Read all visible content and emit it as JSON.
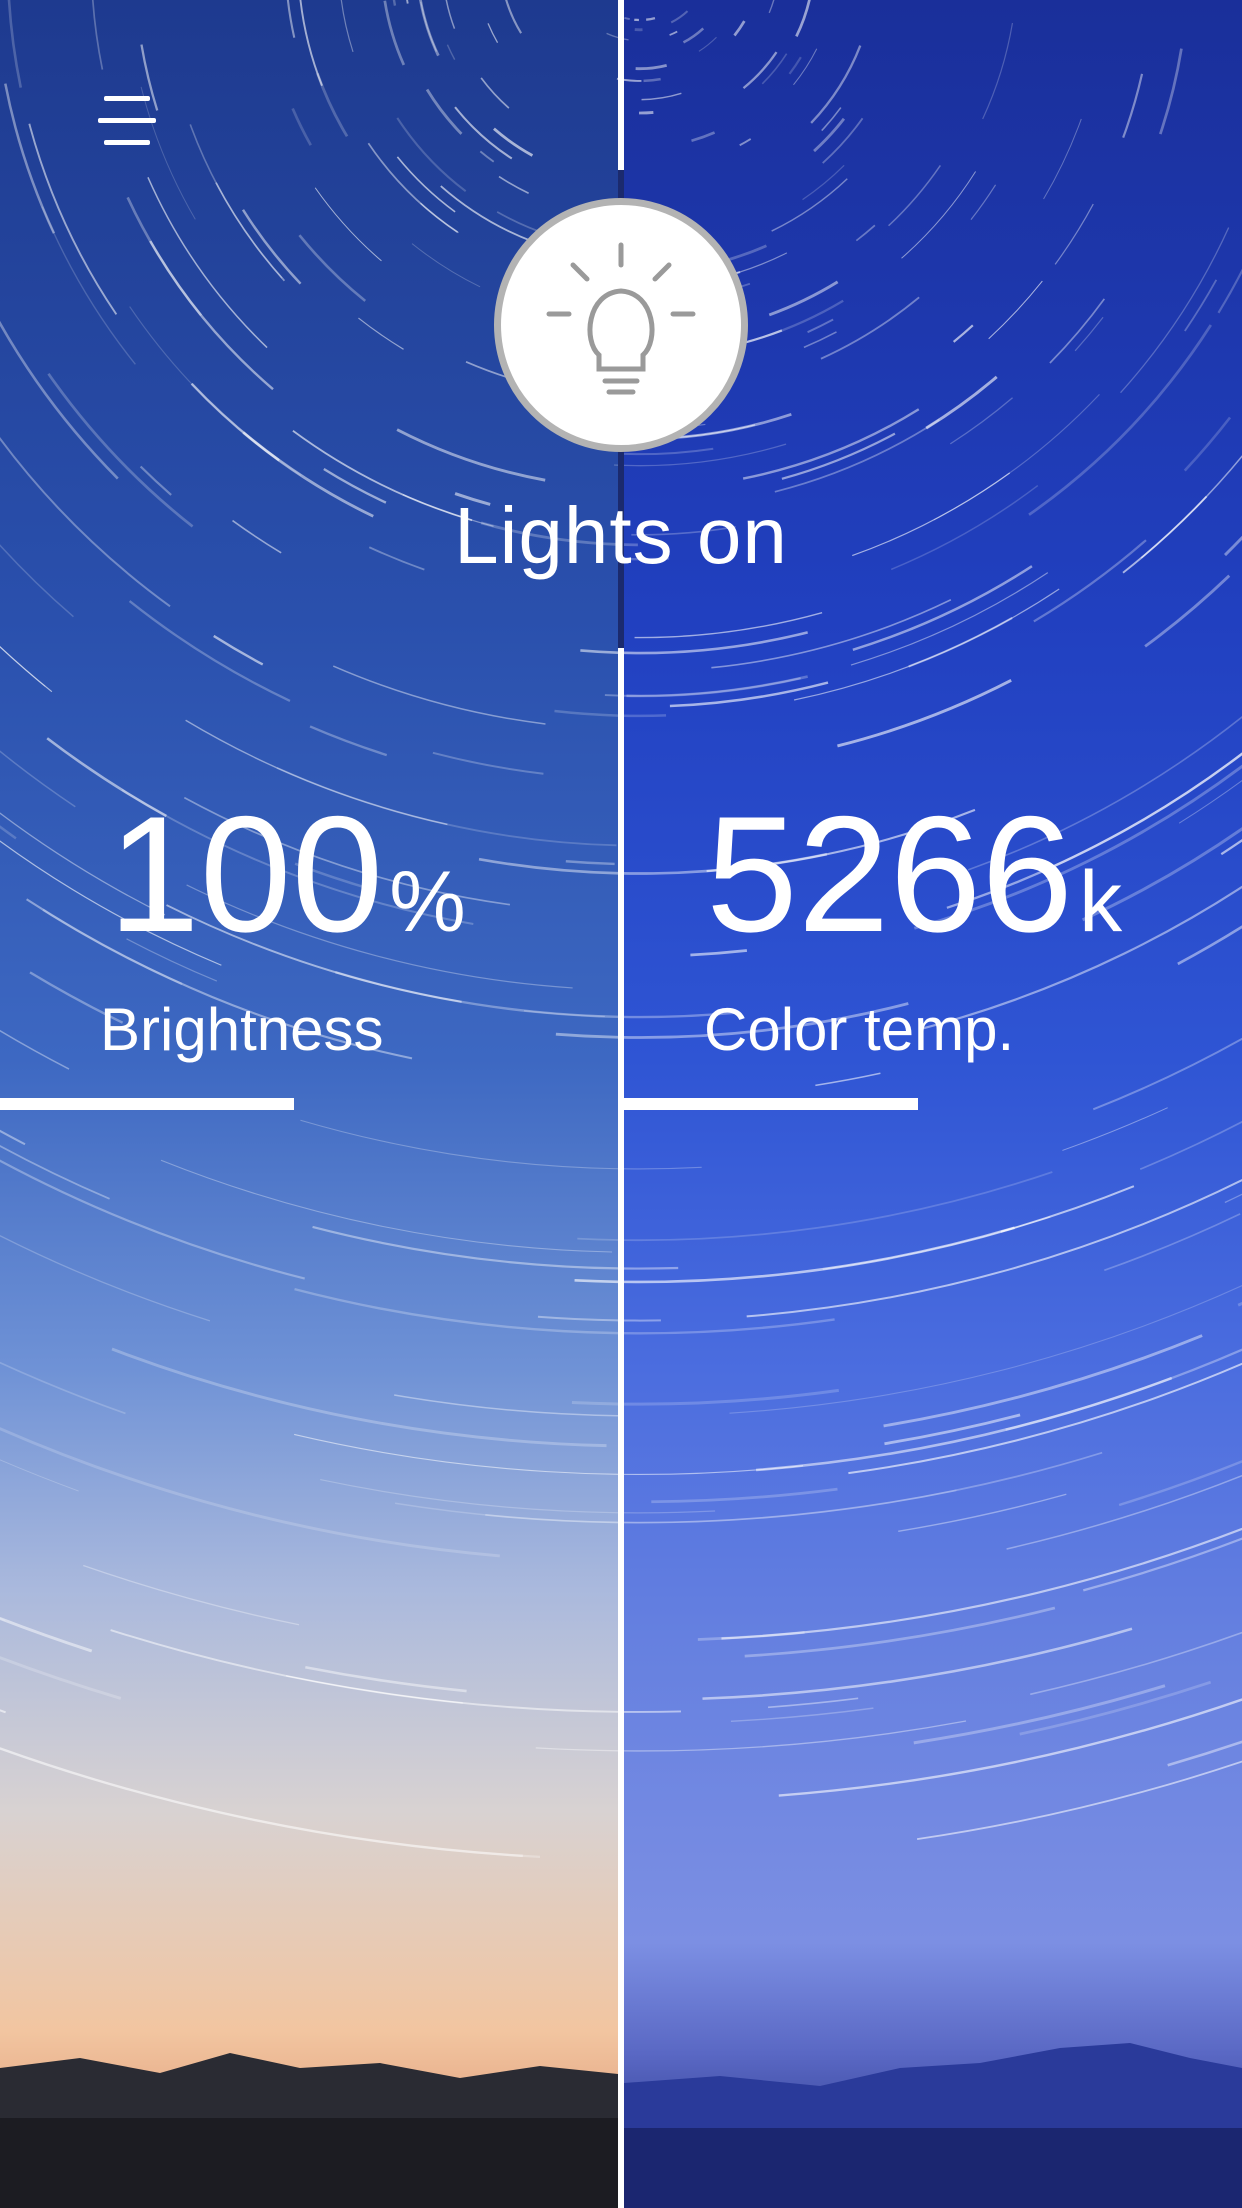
{
  "header": {
    "menu_icon": "hamburger-menu-icon"
  },
  "power": {
    "icon": "lightbulb-icon",
    "status": "Lights on"
  },
  "brightness": {
    "value": "100",
    "unit": "%",
    "label": "Brightness",
    "slider_fraction": 0.475
  },
  "color_temp": {
    "value": "5266",
    "unit": "k",
    "label": "Color temp.",
    "slider_fraction": 0.475
  },
  "colors": {
    "accent": "#ffffff",
    "left_sky": "#2a50ad",
    "right_sky": "#2140c0"
  }
}
